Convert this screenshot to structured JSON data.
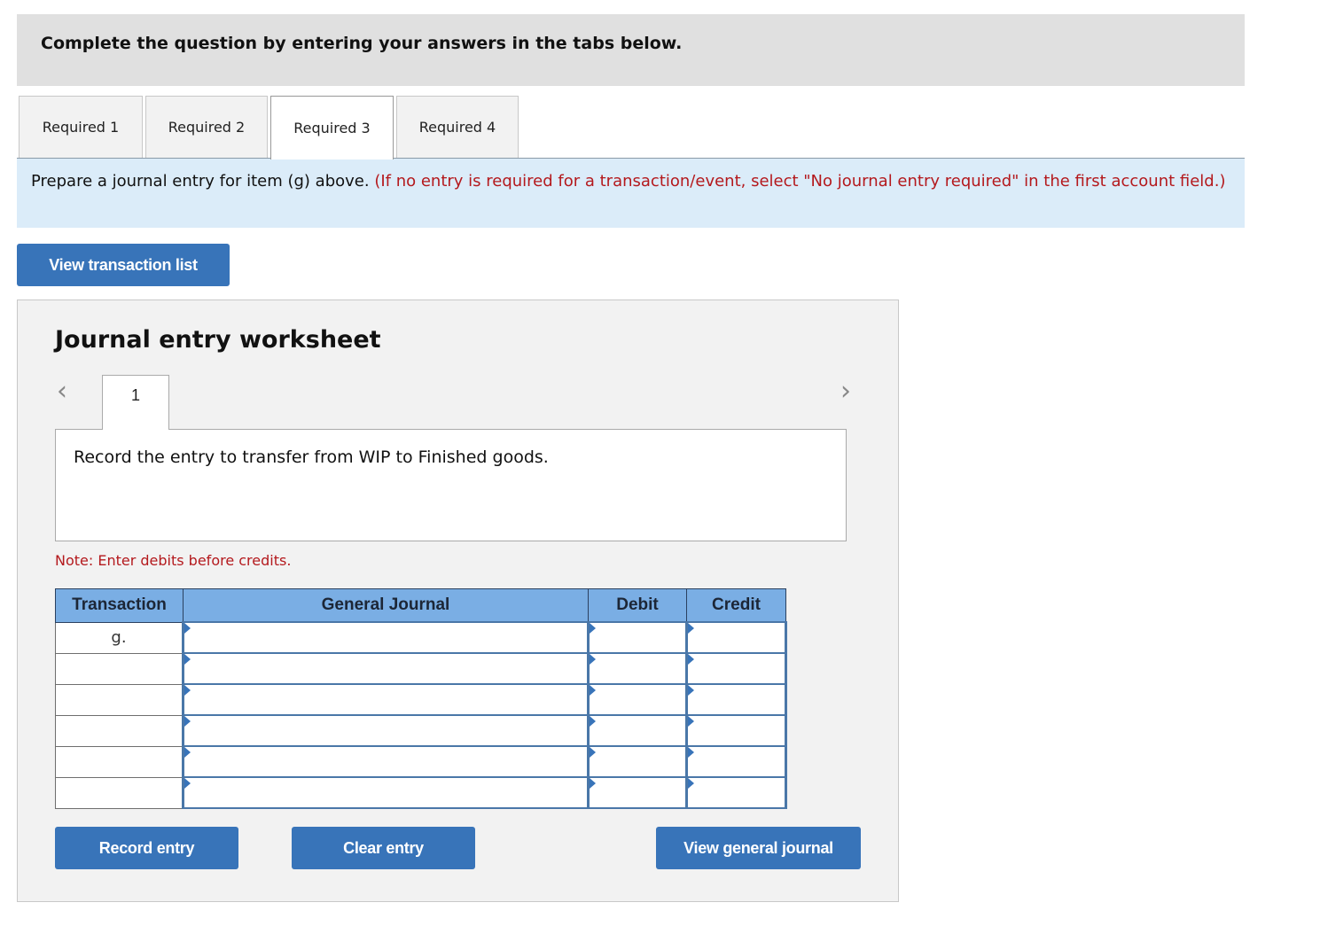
{
  "header": {
    "title": "Complete the question by entering your answers in the tabs below."
  },
  "tabs": [
    {
      "label": "Required 1",
      "active": false
    },
    {
      "label": "Required 2",
      "active": false
    },
    {
      "label": "Required 3",
      "active": true
    },
    {
      "label": "Required 4",
      "active": false
    }
  ],
  "instructions": {
    "main": "Prepare a journal entry for item (g) above. ",
    "note": "(If no entry is required for a transaction/event, select \"No journal entry required\" in the first account field.)"
  },
  "buttons": {
    "view_transaction_list": "View transaction list",
    "record_entry": "Record entry",
    "clear_entry": "Clear entry",
    "view_general_journal": "View general journal"
  },
  "worksheet": {
    "title": "Journal entry worksheet",
    "prev_icon": "‹",
    "next_icon": "›",
    "entry_tab": "1",
    "description": "Record the entry to transfer from WIP to Finished goods.",
    "note": "Note: Enter debits before credits."
  },
  "table": {
    "headers": [
      "Transaction",
      "General Journal",
      "Debit",
      "Credit"
    ],
    "rows": [
      {
        "transaction": "g.",
        "account": "",
        "debit": "",
        "credit": ""
      },
      {
        "transaction": "",
        "account": "",
        "debit": "",
        "credit": ""
      },
      {
        "transaction": "",
        "account": "",
        "debit": "",
        "credit": ""
      },
      {
        "transaction": "",
        "account": "",
        "debit": "",
        "credit": ""
      },
      {
        "transaction": "",
        "account": "",
        "debit": "",
        "credit": ""
      },
      {
        "transaction": "",
        "account": "",
        "debit": "",
        "credit": ""
      }
    ]
  },
  "colors": {
    "accent": "#3874b9",
    "header_row": "#7aaee4",
    "instruction_bg": "#dbecf9",
    "warning_text": "#b4191d"
  }
}
